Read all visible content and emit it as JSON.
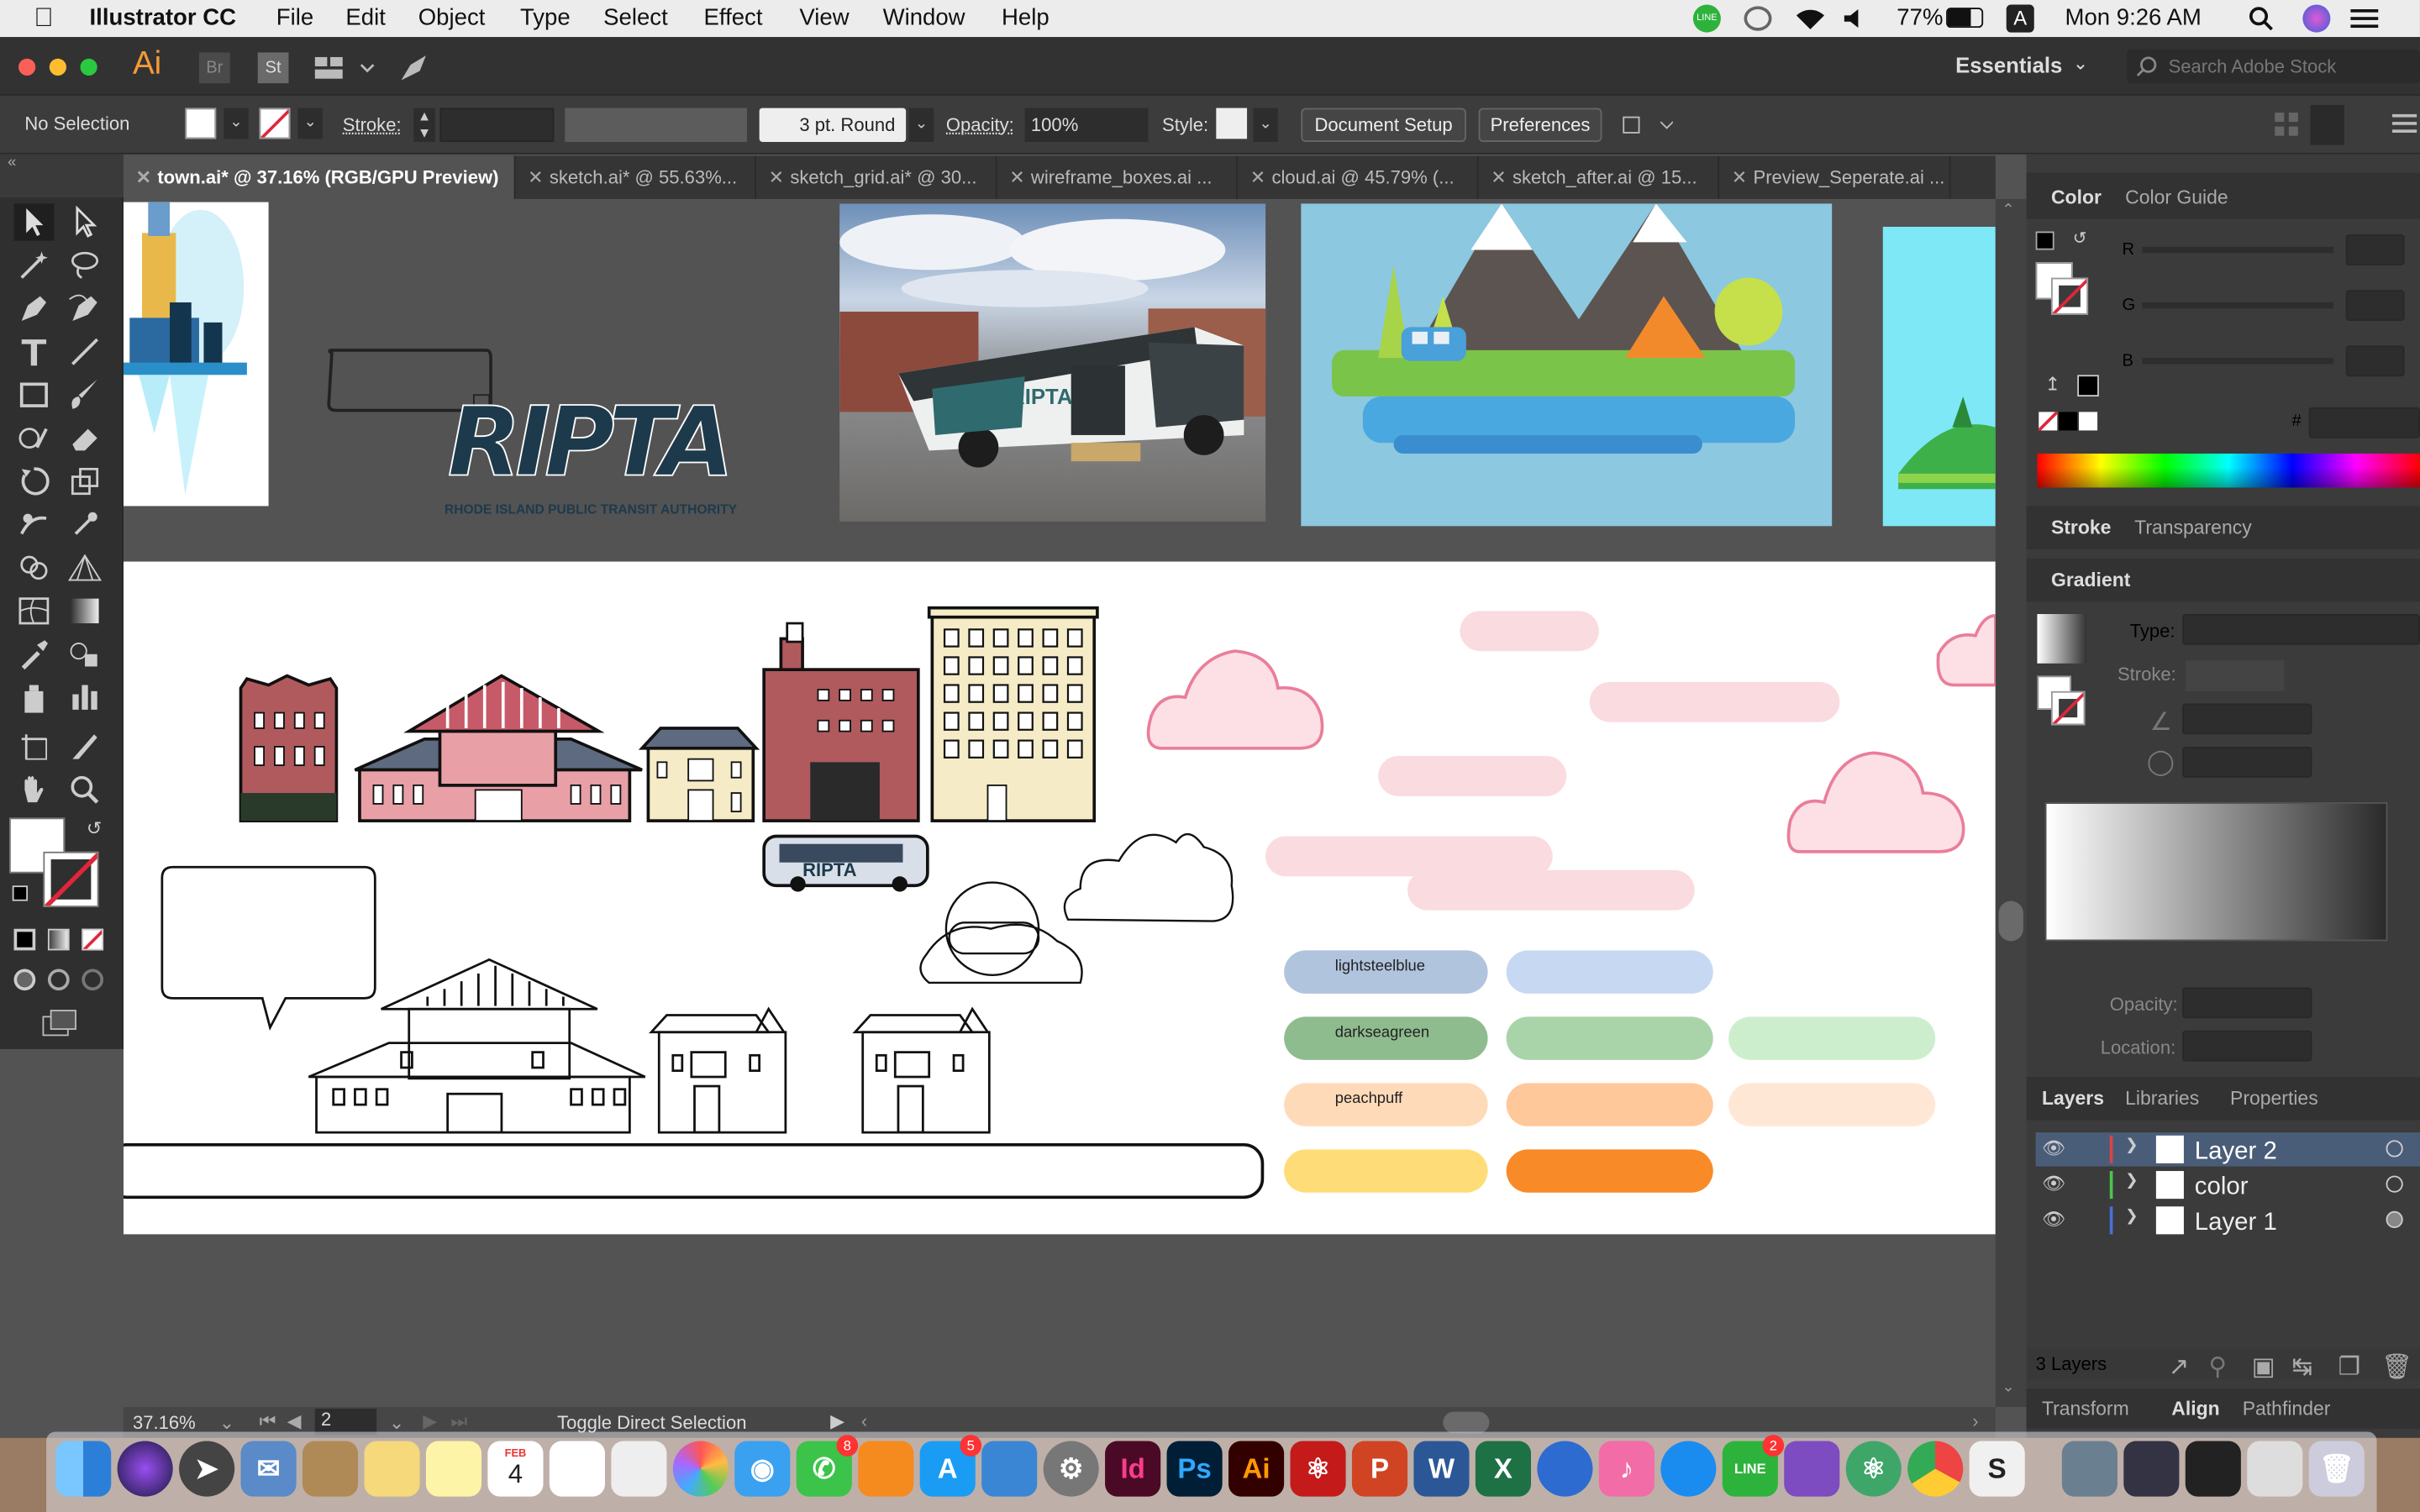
{
  "menubar": {
    "app_name": "Illustrator CC",
    "items": [
      "File",
      "Edit",
      "Object",
      "Type",
      "Select",
      "Effect",
      "View",
      "Window",
      "Help"
    ],
    "battery": "77%",
    "input_source": "A",
    "clock": "Mon 9:26 AM"
  },
  "app": {
    "logo": "Ai",
    "bridge": "Br",
    "stock": "St",
    "workspace": "Essentials",
    "stock_search_placeholder": "Search Adobe Stock"
  },
  "control": {
    "selection": "No Selection",
    "stroke_label": "Stroke:",
    "brush": "3 pt. Round",
    "opacity_label": "Opacity:",
    "opacity_value": "100%",
    "style_label": "Style:",
    "doc_setup": "Document Setup",
    "preferences": "Preferences"
  },
  "tabs": [
    "town.ai* @ 37.16% (RGB/GPU Preview)",
    "sketch.ai* @ 55.63%...",
    "sketch_grid.ai* @ 30...",
    "wireframe_boxes.ai ...",
    "cloud.ai @ 45.79% (...",
    "sketch_after.ai @ 15...",
    "Preview_Seperate.ai ..."
  ],
  "canvas": {
    "logo_text": "RIPTA",
    "logo_subtitle": "RHODE ISLAND PUBLIC TRANSIT AUTHORITY",
    "swatch_labels": [
      "lightsteelblue",
      "darkseagreen",
      "peachpuff"
    ]
  },
  "colors": {
    "lightsteelblue": "#b0c4de",
    "darkseagreen": "#8fbc8f",
    "peachpuff": "#ffdab9",
    "orange": "#f98a28",
    "yellow": "#fedd78",
    "pink": "#fadbe0"
  },
  "status": {
    "zoom": "37.16%",
    "artboard": "2",
    "tool_hint": "Toggle Direct Selection"
  },
  "panels": {
    "color_tab": "Color",
    "color_guide_tab": "Color Guide",
    "r": "R",
    "g": "G",
    "b": "B",
    "hash": "#",
    "stroke_tab": "Stroke",
    "transparency_tab": "Transparency",
    "gradient_tab": "Gradient",
    "type_label": "Type:",
    "stroke_label": "Stroke:",
    "opacity_label": "Opacity:",
    "location_label": "Location:",
    "layers_tab": "Layers",
    "libraries_tab": "Libraries",
    "properties_tab": "Properties",
    "layers": [
      {
        "name": "Layer 2",
        "color": "#d64545"
      },
      {
        "name": "color",
        "color": "#4bc44b"
      },
      {
        "name": "Layer 1",
        "color": "#4a6fd6"
      }
    ],
    "layer_count": "3 Layers",
    "transform_tab": "Transform",
    "align_tab": "Align",
    "pathfinder_tab": "Pathfinder"
  },
  "dock": {
    "badges": {
      "messages": "8",
      "appstore": "5",
      "line": "2"
    },
    "calendar_month": "FEB",
    "calendar_day": "4",
    "apps": [
      "Id",
      "Ps",
      "Ai"
    ]
  }
}
